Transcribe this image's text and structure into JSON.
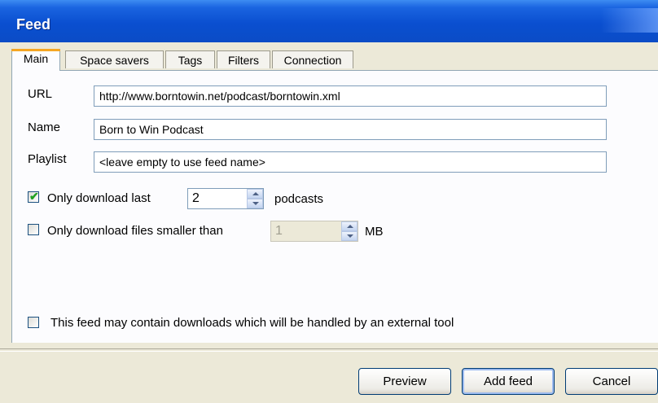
{
  "window": {
    "title": "Feed"
  },
  "tabs": [
    {
      "label": "Main",
      "active": true
    },
    {
      "label": "Space savers",
      "active": false
    },
    {
      "label": "Tags",
      "active": false
    },
    {
      "label": "Filters",
      "active": false
    },
    {
      "label": "Connection",
      "active": false
    }
  ],
  "form": {
    "url_label": "URL",
    "url_value": "http://www.borntowin.net/podcast/borntowin.xml",
    "name_label": "Name",
    "name_value": "Born to Win Podcast",
    "playlist_label": "Playlist",
    "playlist_placeholder": "<leave empty to use feed name>"
  },
  "options": {
    "download_last": {
      "label": "Only download last",
      "checked": true,
      "value": "2",
      "suffix": "podcasts"
    },
    "smaller_than": {
      "label": "Only download files smaller than",
      "checked": false,
      "value": "1",
      "suffix": "MB"
    },
    "external_tool": {
      "label": "This feed may contain downloads which will be handled by an external tool",
      "checked": false
    }
  },
  "buttons": {
    "preview": "Preview",
    "add_feed": "Add feed",
    "cancel": "Cancel"
  },
  "colors": {
    "titlebar": "#0a4fd0",
    "tab_highlight": "#f5a623",
    "check_mark": "#21a121"
  }
}
